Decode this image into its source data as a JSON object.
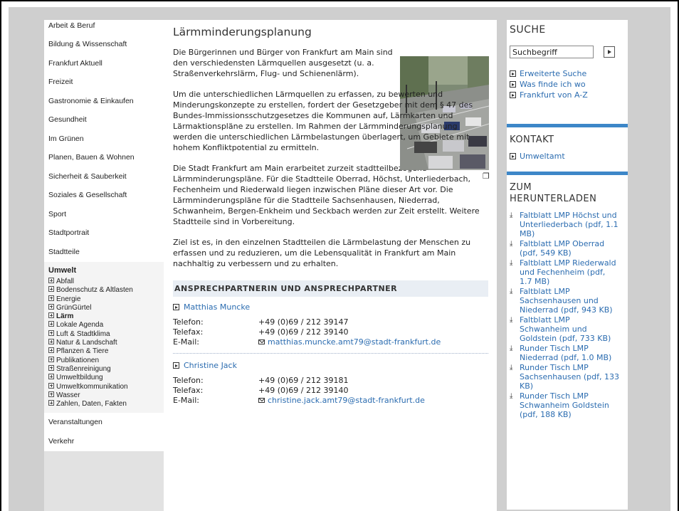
{
  "nav": {
    "items_top": [
      "Arbeit & Beruf",
      "Bildung & Wissenschaft",
      "Frankfurt Aktuell",
      "Freizeit",
      "Gastronomie & Einkaufen",
      "Gesundheit",
      "Im Grünen",
      "Planen, Bauen & Wohnen",
      "Sicherheit & Sauberkeit",
      "Soziales & Gesellschaft",
      "Sport",
      "Stadtportrait",
      "Stadtteile"
    ],
    "active_heading": "Umwelt",
    "sub_items": [
      "Abfall",
      "Bodenschutz & Altlasten",
      "Energie",
      "GrünGürtel",
      "Lärm",
      "Lokale Agenda",
      "Luft & Stadtklima",
      "Natur & Landschaft",
      "Pflanzen & Tiere",
      "Publikationen",
      "Straßenreinigung",
      "Umweltbildung",
      "Umweltkommunikation",
      "Wasser",
      "Zahlen, Daten, Fakten"
    ],
    "active_sub": "Lärm",
    "items_bottom": [
      "Veranstaltungen",
      "Verkehr"
    ]
  },
  "main": {
    "title": "Lärmminderungsplanung",
    "para1": "Die Bürgerinnen und Bürger von Frankfurt am Main sind den verschiedensten Lärmquellen ausgesetzt (u. a. Straßenverkehrslärm, Flug- und Schienenlärm).",
    "para2": "Um die unterschiedlichen Lärmquellen zu erfassen, zu bewerten und Minderungskonzepte zu erstellen, fordert der Gesetzgeber mit dem § 47 des Bundes-Immissionsschutzgesetzes die Kommunen auf, Lärmkarten und Lärmaktionspläne zu erstellen. Im Rahmen der Lärmminderungsplanung werden die unterschiedlichen Lärmbelastungen überlagert, um Gebiete mit hohem Konfliktpotential zu ermitteln.",
    "para3": "Die Stadt Frankfurt am Main erarbeitet zurzeit stadtteilbezogene Lärmminderungspläne. Für die Stadtteile Oberrad, Höchst, Unterliederbach, Fechenheim und Riederwald liegen inzwischen Pläne dieser Art vor. Die Lärmminderungspläne für die Stadtteile Sachsenhausen, Niederrad, Schwanheim, Bergen-Enkheim und Seckbach werden zur Zeit erstellt. Weitere Stadtteile sind in Vorbereitung.",
    "para4": "Ziel ist es, in den einzelnen Stadtteilen die Lärmbelastung der Menschen zu erfassen und zu reduzieren, um die Lebensqualität in Frankfurt am Main nachhaltig zu verbessern und zu erhalten.",
    "contact_heading": "ANSPRECHPARTNERIN UND ANSPRECHPARTNER",
    "labels": {
      "phone": "Telefon:",
      "fax": "Telefax:",
      "email": "E-Mail:"
    },
    "persons": [
      {
        "name": "Matthias Muncke",
        "phone": "+49 (0)69 / 212 39147",
        "fax": "+49 (0)69 / 212 39140",
        "email": "matthias.muncke.amt79@stadt-frankfurt.de"
      },
      {
        "name": "Christine Jack",
        "phone": "+49 (0)69 / 212 39181",
        "fax": "+49 (0)69 / 212 39140",
        "email": "christine.jack.amt79@stadt-frankfurt.de"
      }
    ]
  },
  "right": {
    "search_title": "SUCHE",
    "search_value": "Suchbegriff",
    "search_links": [
      "Erweiterte Suche",
      "Was finde ich wo",
      "Frankfurt von A-Z"
    ],
    "contact_title": "KONTAKT",
    "contact_link": "Umweltamt",
    "downloads_title": "ZUM HERUNTERLADEN",
    "downloads": [
      "Faltblatt LMP Höchst und Unterliederbach (pdf, 1.1 MB)",
      "Faltblatt LMP Oberrad (pdf, 549 KB)",
      "Faltblatt LMP Riederwald und Fechenheim (pdf, 1.7 MB)",
      "Faltblatt LMP Sachsenhausen und Niederrad (pdf, 943 KB)",
      "Faltblatt LMP Schwanheim und Goldstein (pdf, 733 KB)",
      "Runder Tisch LMP Niederrad (pdf, 1.0 MB)",
      "Runder Tisch LMP Sachsenhausen (pdf, 133 KB)",
      "Runder Tisch LMP Schwanheim Goldstein (pdf, 188 KB)"
    ]
  },
  "colors": {
    "link": "#2b6cb0",
    "accent_bar": "#3d87c8",
    "page_bg": "#cfcfcf"
  },
  "icons": {
    "expand": "plus-box-icon",
    "link_arrow": "arrow-box-icon",
    "download": "download-icon",
    "mail": "mail-icon",
    "enlarge": "enlarge-image-icon"
  }
}
